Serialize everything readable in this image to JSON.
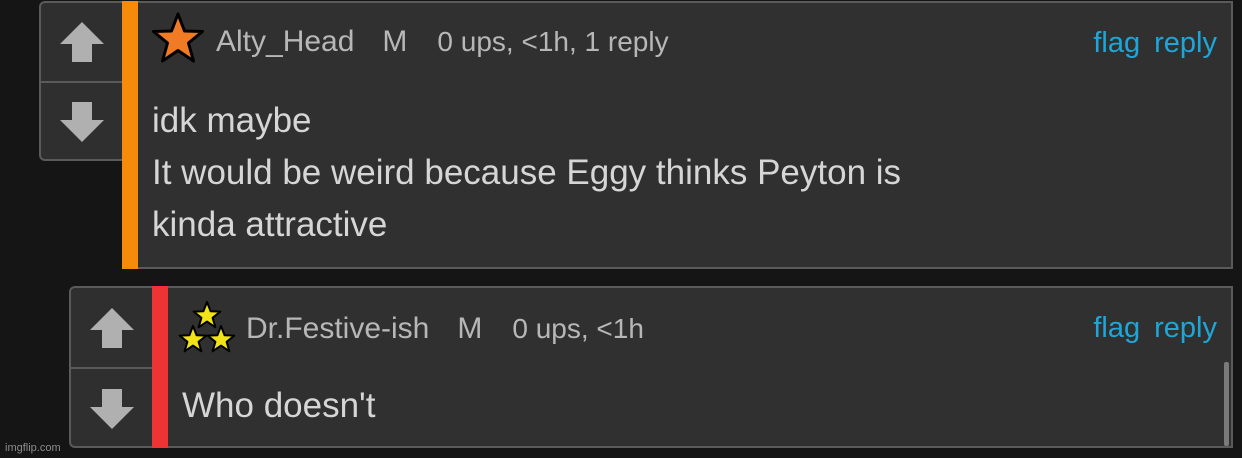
{
  "comments": [
    {
      "username": "Alty_Head",
      "role": "M",
      "stats": "0 ups, <1h, 1 reply",
      "flag_label": "flag",
      "reply_label": "reply",
      "rank_icon": "orange-star-icon",
      "stripe_color": "#f58a0b",
      "lines": [
        "idk maybe",
        "It would be weird because Eggy thinks Peyton is",
        "kinda attractive"
      ]
    },
    {
      "username": "Dr.Festive-ish",
      "role": "M",
      "stats": "0 ups, <1h",
      "flag_label": "flag",
      "reply_label": "reply",
      "rank_icon": "three-stars-icon",
      "stripe_color": "#ee3333",
      "lines": [
        "Who doesn't"
      ]
    }
  ],
  "watermark": "imgflip.com",
  "colors": {
    "link": "#1fa6d9",
    "panel": "#303030",
    "border": "#5a5a5a"
  }
}
